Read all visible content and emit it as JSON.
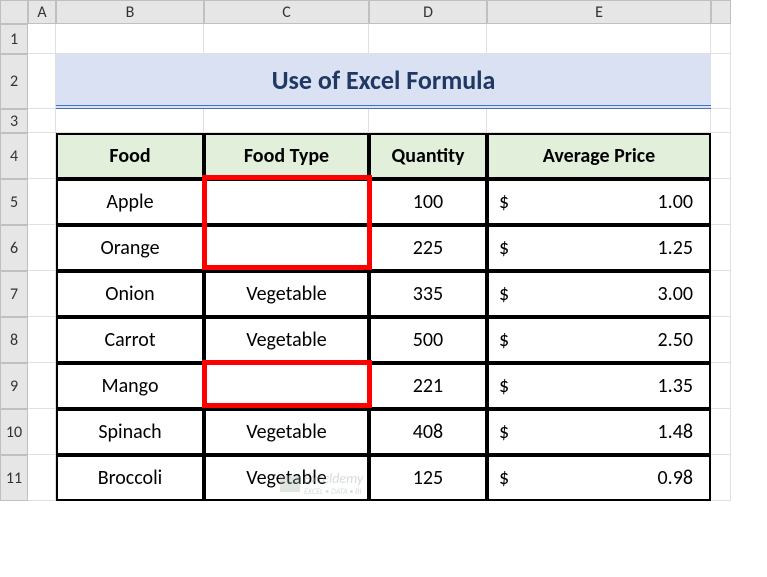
{
  "columns": [
    "A",
    "B",
    "C",
    "D",
    "E"
  ],
  "rows": [
    "1",
    "2",
    "3",
    "4",
    "5",
    "6",
    "7",
    "8",
    "9",
    "10",
    "11"
  ],
  "title": "Use of Excel Formula",
  "headers": {
    "food": "Food",
    "food_type": "Food Type",
    "quantity": "Quantity",
    "avg_price": "Average Price"
  },
  "currency": "$",
  "data": [
    {
      "food": "Apple",
      "type": "",
      "qty": "100",
      "price": "1.00"
    },
    {
      "food": "Orange",
      "type": "",
      "qty": "225",
      "price": "1.25"
    },
    {
      "food": "Onion",
      "type": "Vegetable",
      "qty": "335",
      "price": "3.00"
    },
    {
      "food": "Carrot",
      "type": "Vegetable",
      "qty": "500",
      "price": "2.50"
    },
    {
      "food": "Mango",
      "type": "",
      "qty": "221",
      "price": "1.35"
    },
    {
      "food": "Spinach",
      "type": "Vegetable",
      "qty": "408",
      "price": "1.48"
    },
    {
      "food": "Broccoli",
      "type": "Vegetable",
      "qty": "125",
      "price": "0.98"
    }
  ],
  "watermark": {
    "brand": "Exceldemy",
    "tag": "EXCEL • DATA • BI"
  },
  "chart_data": {
    "type": "table",
    "title": "Use of Excel Formula",
    "columns": [
      "Food",
      "Food Type",
      "Quantity",
      "Average Price ($)"
    ],
    "rows": [
      [
        "Apple",
        "",
        100,
        1.0
      ],
      [
        "Orange",
        "",
        225,
        1.25
      ],
      [
        "Onion",
        "Vegetable",
        335,
        3.0
      ],
      [
        "Carrot",
        "Vegetable",
        500,
        2.5
      ],
      [
        "Mango",
        "",
        221,
        1.35
      ],
      [
        "Spinach",
        "Vegetable",
        408,
        1.48
      ],
      [
        "Broccoli",
        "Vegetable",
        125,
        0.98
      ]
    ]
  }
}
